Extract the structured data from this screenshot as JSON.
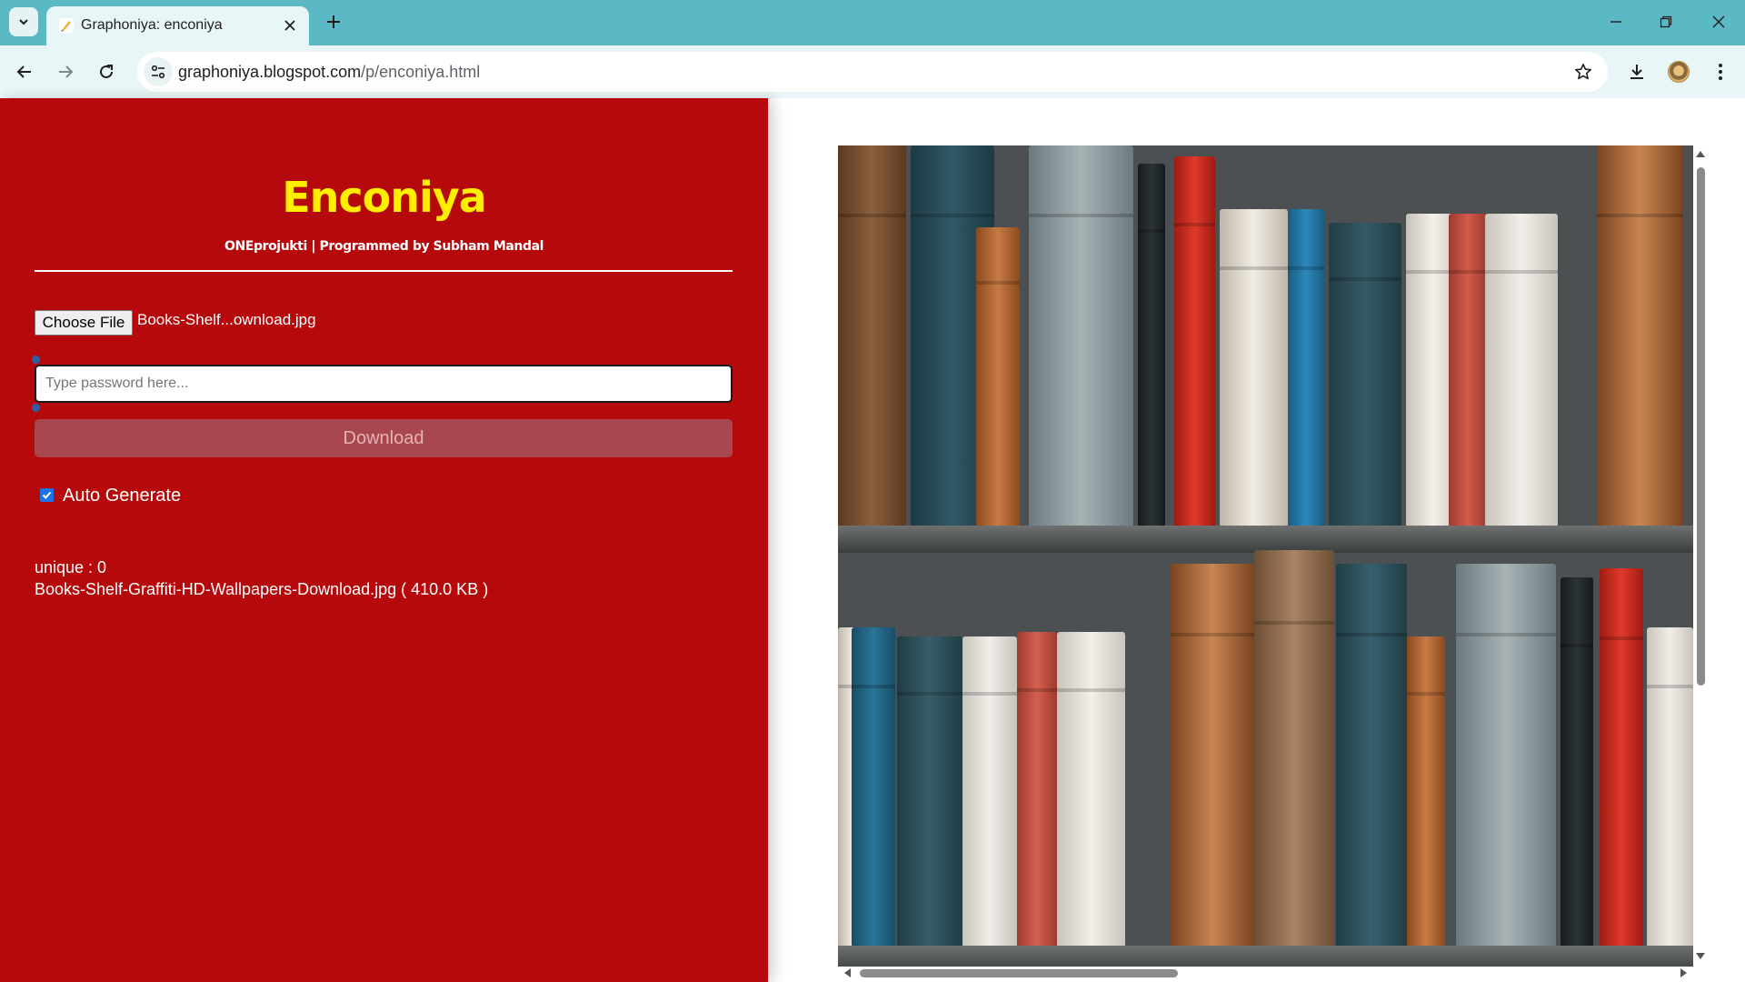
{
  "browser": {
    "tab_title": "Graphoniya: enconiya",
    "url_host": "graphoniya.blogspot.com",
    "url_path": "/p/enconiya.html"
  },
  "app": {
    "title": "Enconiya",
    "subtitle": "ONEprojukti | Programmed by Subham Mandal",
    "choose_file_label": "Choose File",
    "file_name": "Books-Shelf...ownload.jpg",
    "password_placeholder": "Type password here...",
    "download_label": "Download",
    "auto_generate_label": "Auto Generate",
    "auto_generate_checked": true,
    "unique_text": "unique : 0",
    "file_info_text": "Books-Shelf-Graffiti-HD-Wallpapers-Download.jpg ( 410.0 KB )"
  },
  "preview": {
    "image_subject": "bookshelf with old books"
  },
  "colors": {
    "tabbar": "#5bb9c6",
    "toolbar": "#e9f6f7",
    "panel_red": "#b5090b",
    "title_yellow": "#ffee00",
    "download_button": "#a8474e"
  }
}
